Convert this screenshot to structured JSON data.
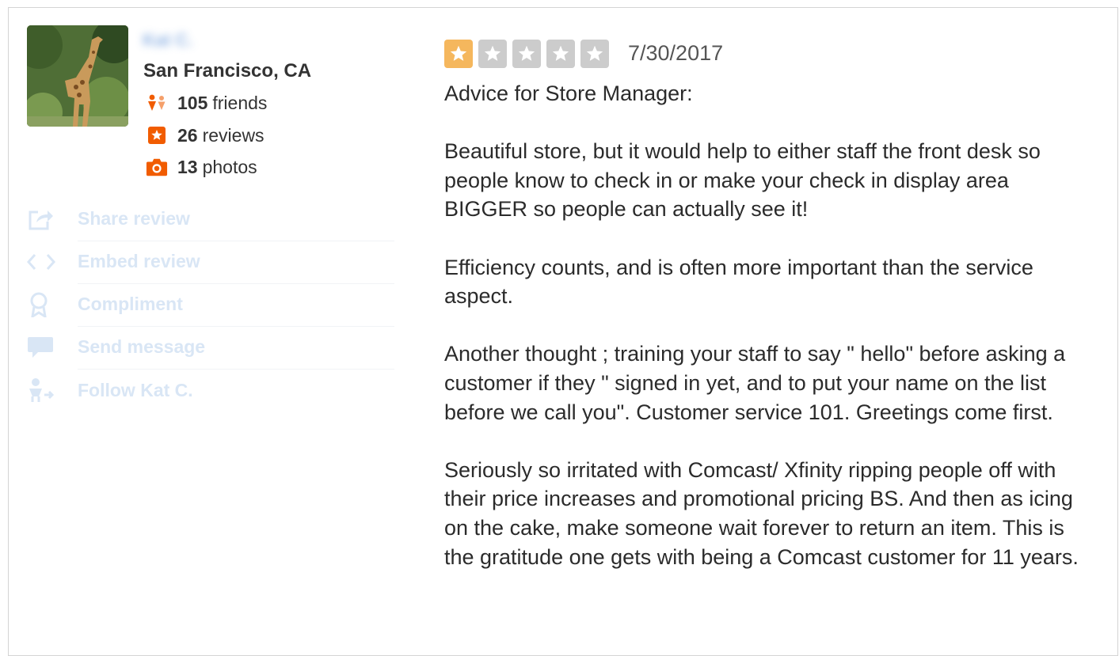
{
  "user": {
    "name": "Kat C.",
    "location": "San Francisco, CA",
    "stats": [
      {
        "icon": "friends-icon",
        "count": "105",
        "label": "friends"
      },
      {
        "icon": "review-star-icon",
        "count": "26",
        "label": "reviews"
      },
      {
        "icon": "camera-icon",
        "count": "13",
        "label": "photos"
      }
    ]
  },
  "actions": [
    {
      "icon": "share-icon",
      "label": "Share review"
    },
    {
      "icon": "embed-icon",
      "label": "Embed review"
    },
    {
      "icon": "compliment-icon",
      "label": "Compliment"
    },
    {
      "icon": "message-icon",
      "label": "Send message"
    },
    {
      "icon": "follow-icon",
      "label": "Follow Kat C."
    }
  ],
  "review": {
    "rating": 1,
    "max_rating": 5,
    "date": "7/30/2017",
    "paragraphs": [
      "Advice for Store Manager:",
      "Beautiful store, but it would help to either staff the front desk so people know to check in or make your check in display area BIGGER so people can actually see it!",
      "Efficiency counts, and is often more important than the service aspect.",
      "Another thought ; training your staff to say \" hello\" before asking a customer if they \" signed in yet, and to put your name on the list before we call you\". Customer service 101. Greetings come first.",
      "Seriously so irritated with Comcast/ Xfinity ripping people off with their price increases and promotional pricing BS. And then as icing on the cake, make someone wait forever to return an item.  This is the gratitude one gets with being a Comcast customer for 11 years."
    ]
  },
  "colors": {
    "accent": "#f15c00",
    "star_active": "#f5b75d",
    "star_inactive": "#cccccc",
    "action_text": "#d9e6f5"
  }
}
